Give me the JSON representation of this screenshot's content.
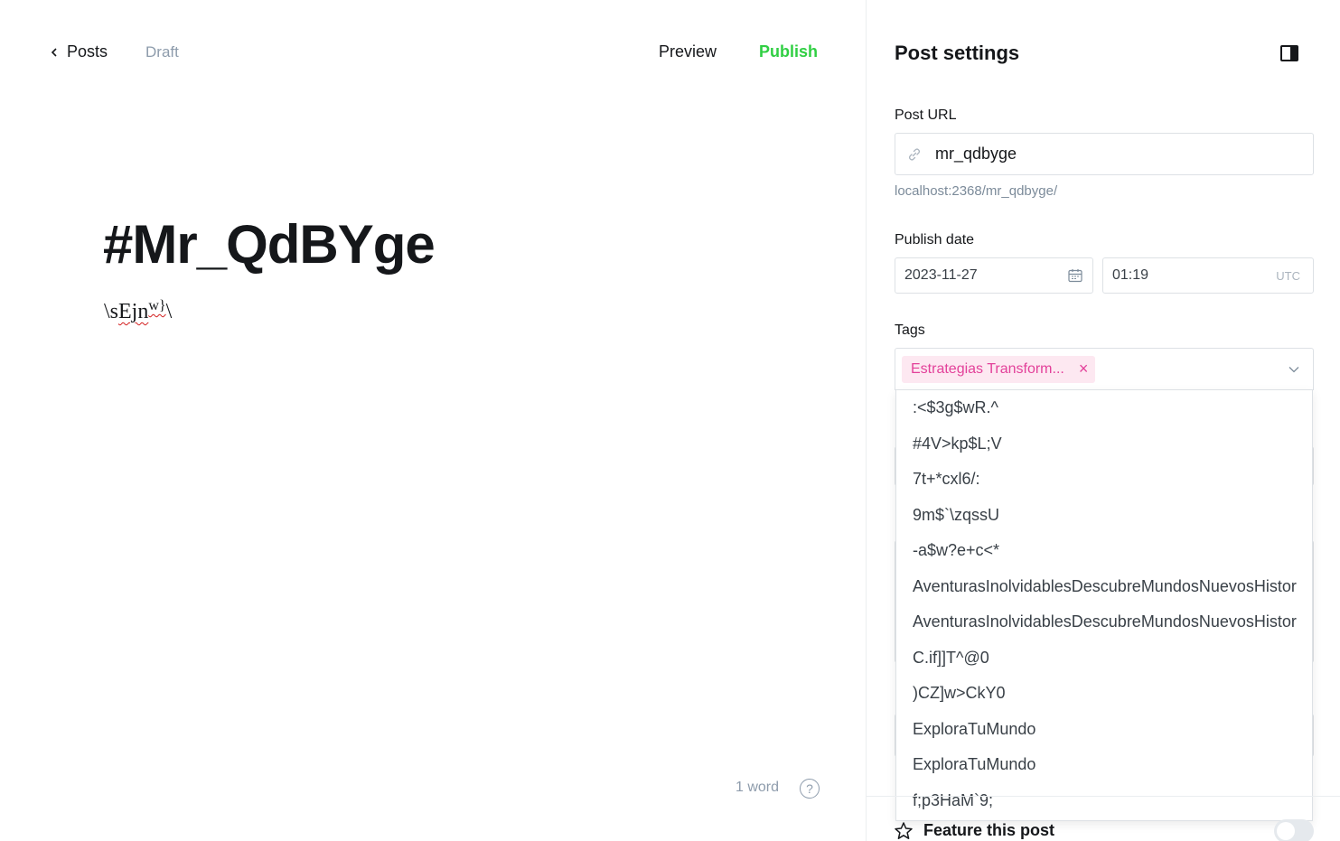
{
  "editor": {
    "back_label": "Posts",
    "status": "Draft",
    "preview_label": "Preview",
    "publish_label": "Publish",
    "title": "#Mr_QdBYge",
    "body_prefix": "\\s",
    "body_misspelled": "Ejn",
    "body_sup": "w}",
    "body_suffix": "\\",
    "word_count": "1 word",
    "help_glyph": "?"
  },
  "settings": {
    "title": "Post settings",
    "post_url_label": "Post URL",
    "post_url_value": "mr_qdbyge",
    "post_url_hint": "localhost:2368/mr_qdbyge/",
    "publish_date_label": "Publish date",
    "date_value": "2023-11-27",
    "time_value": "01:19",
    "timezone": "UTC",
    "tags_label": "Tags",
    "selected_tag": "Estrategias Transform...",
    "tag_remove_glyph": "×",
    "tag_options": [
      ":<$3g$wR.^",
      "#4V>kp$L;V",
      "7t+*cxl6/:",
      "9m$`\\zqssU",
      "-a$w?e+c<*",
      "AventurasInolvidablesDescubreMundosNuevosHistor",
      "AventurasInolvidablesDescubreMundosNuevosHistor",
      "C.if]]T^@0",
      ")CZ]w>CkY0",
      "ExploraTuMundo",
      "ExploraTuMundo",
      "f;p3HaM`9;"
    ],
    "feature_label": "Feature this post",
    "feature_enabled": false
  },
  "colors": {
    "publish_green": "#30cf43",
    "tag_pink": "#e3419a",
    "tag_bg": "#fde8f1"
  }
}
